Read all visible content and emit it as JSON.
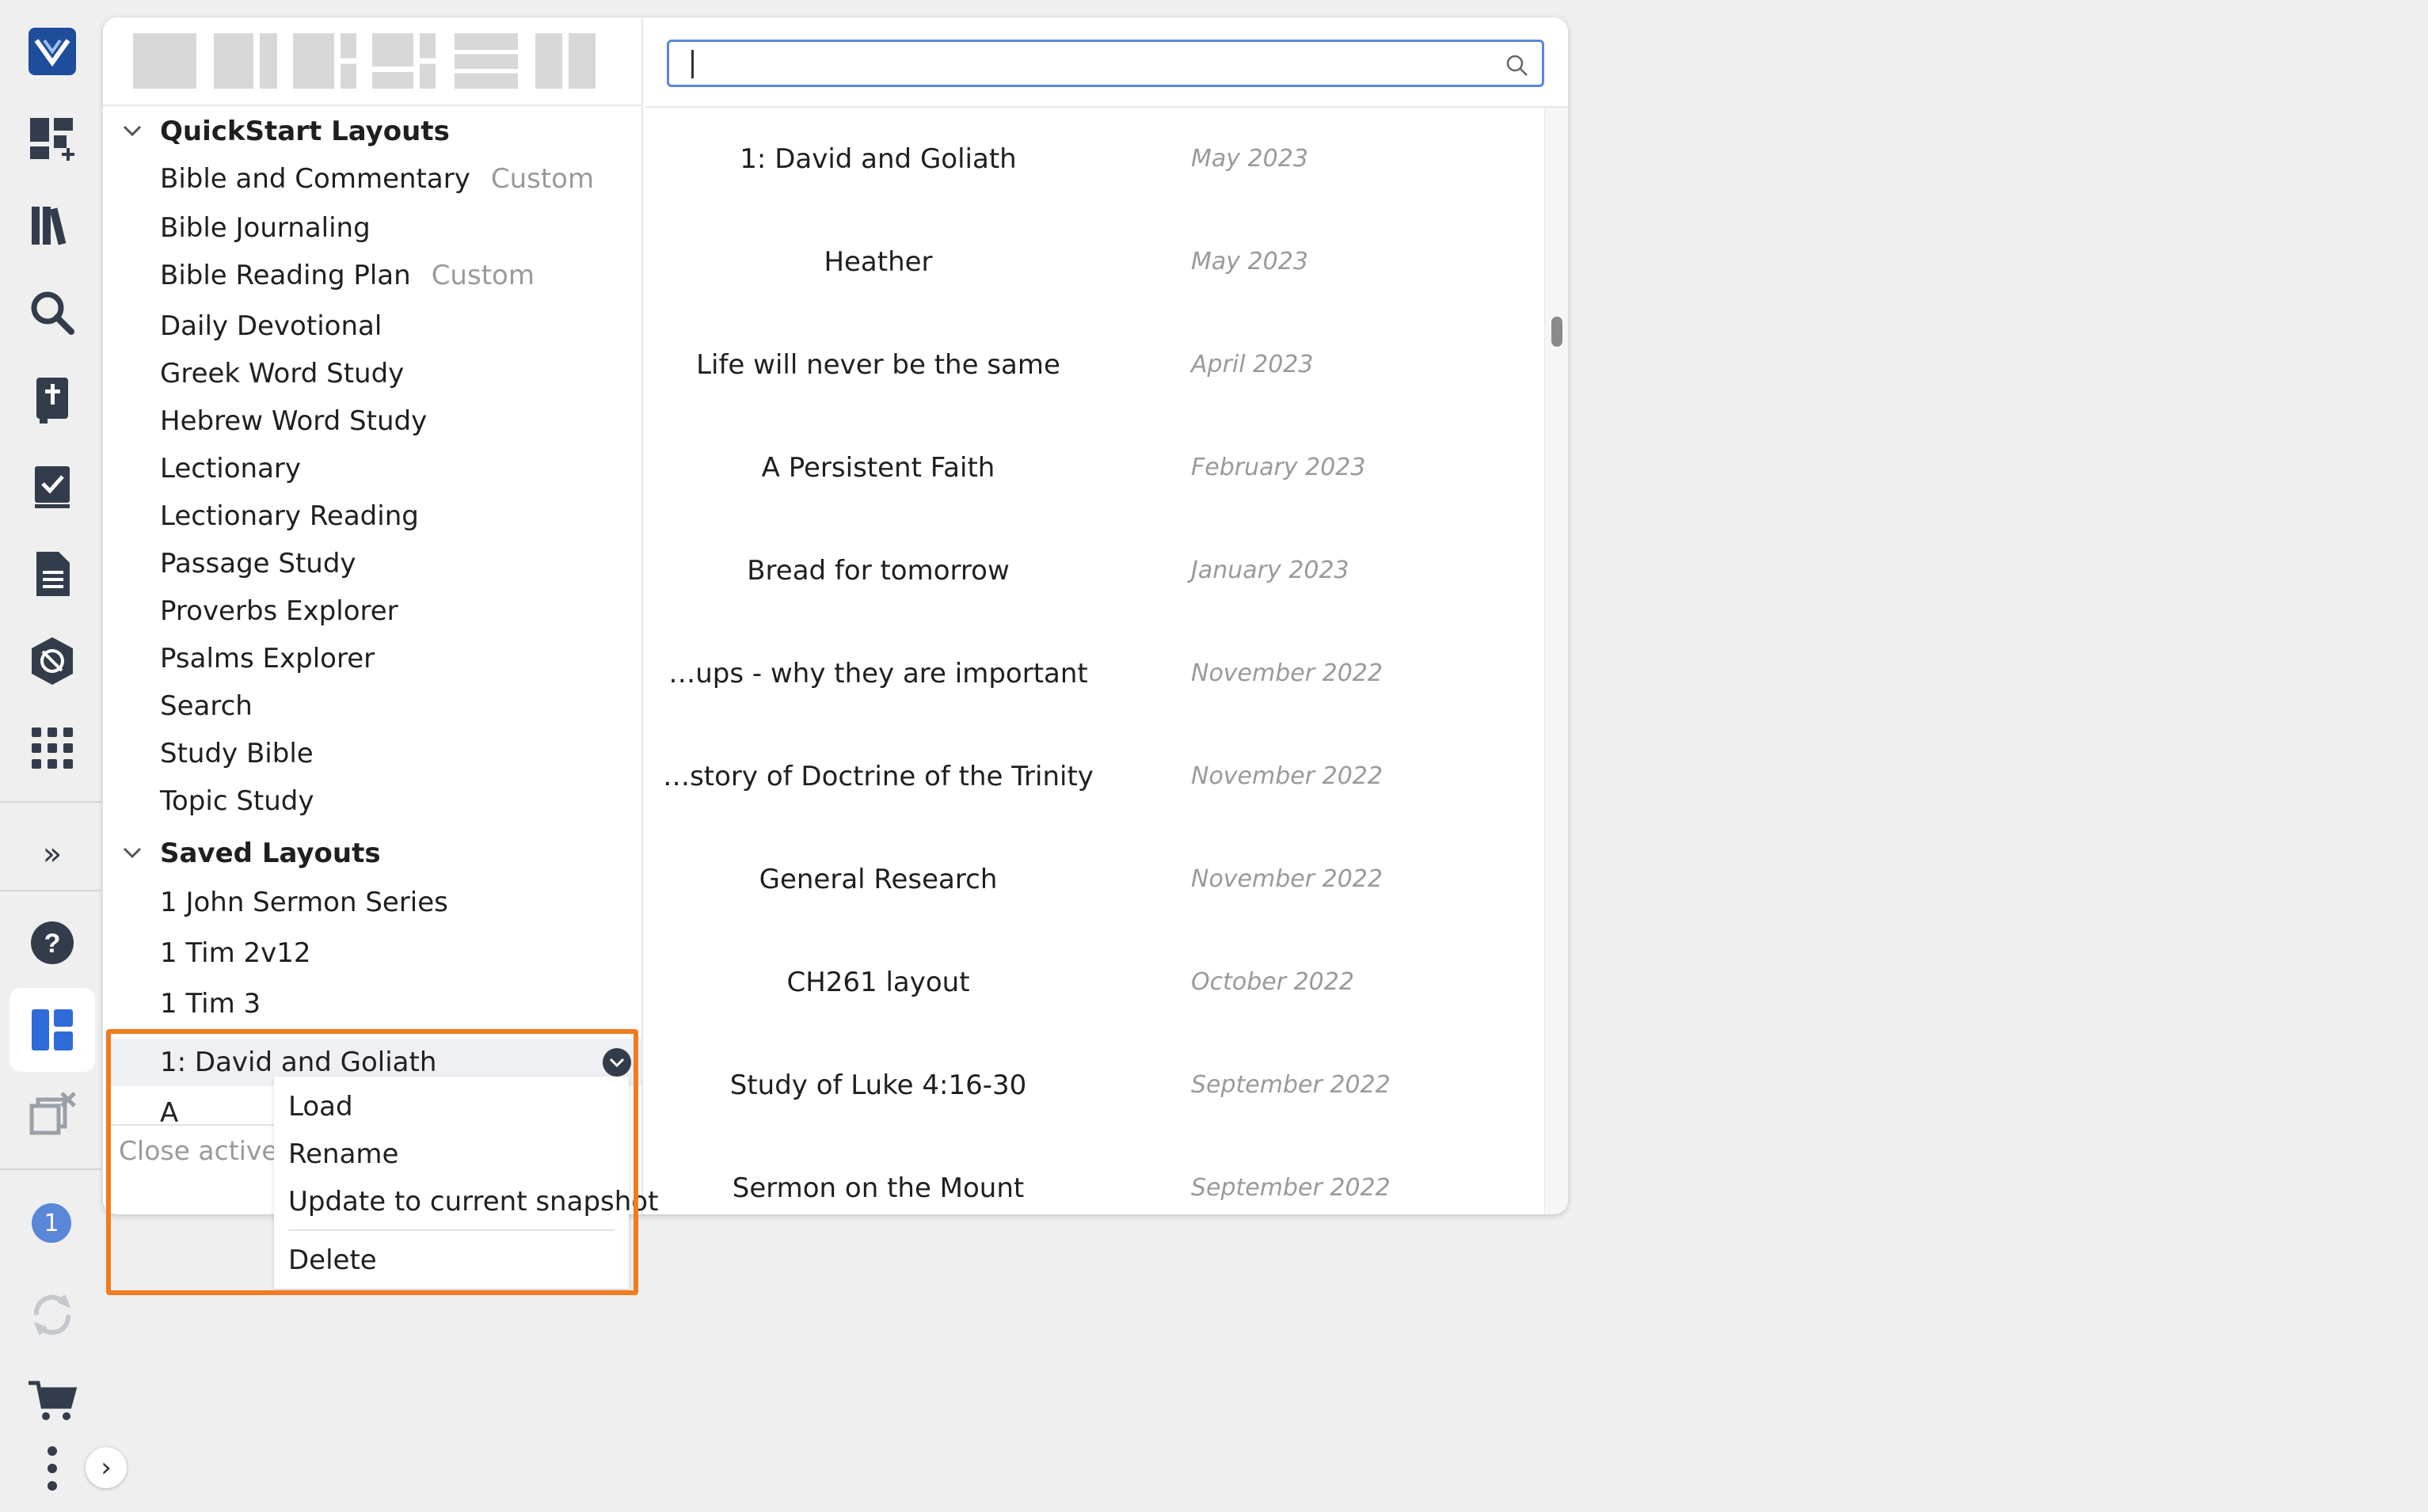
{
  "colors": {
    "accent": "#1e4d9c",
    "highlight": "#f07b20",
    "active_icon": "#2f6bd8",
    "muted": "#9a9a9a"
  },
  "rail": {
    "icons": [
      "logos-logo-icon",
      "dashboard-add-icon",
      "library-icon",
      "search-icon",
      "bible-icon",
      "checklist-icon",
      "document-icon",
      "shield-icon",
      "apps-grid-icon",
      "expand-icon",
      "help-icon",
      "layouts-icon",
      "close-windows-icon",
      "sync-icon",
      "cart-icon",
      "more-icon"
    ],
    "badge": "1",
    "expand_glyph": "›",
    "collapse_glyph": "»"
  },
  "quickstart": {
    "header": "QuickStart Layouts",
    "items": [
      {
        "label": "Bible and Commentary",
        "tag": "Custom"
      },
      {
        "label": "Bible Journaling",
        "tag": ""
      },
      {
        "label": "Bible Reading Plan",
        "tag": "Custom"
      },
      {
        "label": "Daily Devotional",
        "tag": ""
      },
      {
        "label": "Greek Word Study",
        "tag": ""
      },
      {
        "label": "Hebrew Word Study",
        "tag": ""
      },
      {
        "label": "Lectionary",
        "tag": ""
      },
      {
        "label": "Lectionary Reading",
        "tag": ""
      },
      {
        "label": "Passage Study",
        "tag": ""
      },
      {
        "label": "Proverbs Explorer",
        "tag": ""
      },
      {
        "label": "Psalms Explorer",
        "tag": ""
      },
      {
        "label": "Search",
        "tag": ""
      },
      {
        "label": "Study Bible",
        "tag": ""
      },
      {
        "label": "Topic Study",
        "tag": ""
      }
    ]
  },
  "saved": {
    "header": "Saved Layouts",
    "items": [
      {
        "label": "1 John Sermon Series"
      },
      {
        "label": "1 Tim 2v12"
      },
      {
        "label": "1 Tim 3"
      },
      {
        "label": "1: David and Goliath"
      },
      {
        "label": "A"
      }
    ]
  },
  "close_active": "Close active l",
  "context_menu": {
    "items": [
      "Load",
      "Rename",
      "Update to current snapshot",
      "Delete"
    ]
  },
  "search": {
    "value": "",
    "placeholder": ""
  },
  "results": [
    {
      "name": "1: David and Goliath",
      "date": "May 2023"
    },
    {
      "name": "Heather",
      "date": "May 2023"
    },
    {
      "name": "Life will never be the same",
      "date": "April 2023"
    },
    {
      "name": "A Persistent Faith",
      "date": "February 2023"
    },
    {
      "name": "Bread for tomorrow",
      "date": "January 2023"
    },
    {
      "name": "…ups - why they are important",
      "date": "November 2022"
    },
    {
      "name": "…story of Doctrine of the Trinity",
      "date": "November 2022"
    },
    {
      "name": "General Research",
      "date": "November 2022"
    },
    {
      "name": "CH261 layout",
      "date": "October 2022"
    },
    {
      "name": "Study of Luke 4:16-30",
      "date": "September 2022"
    },
    {
      "name": "Sermon on the Mount",
      "date": "September 2022"
    }
  ]
}
